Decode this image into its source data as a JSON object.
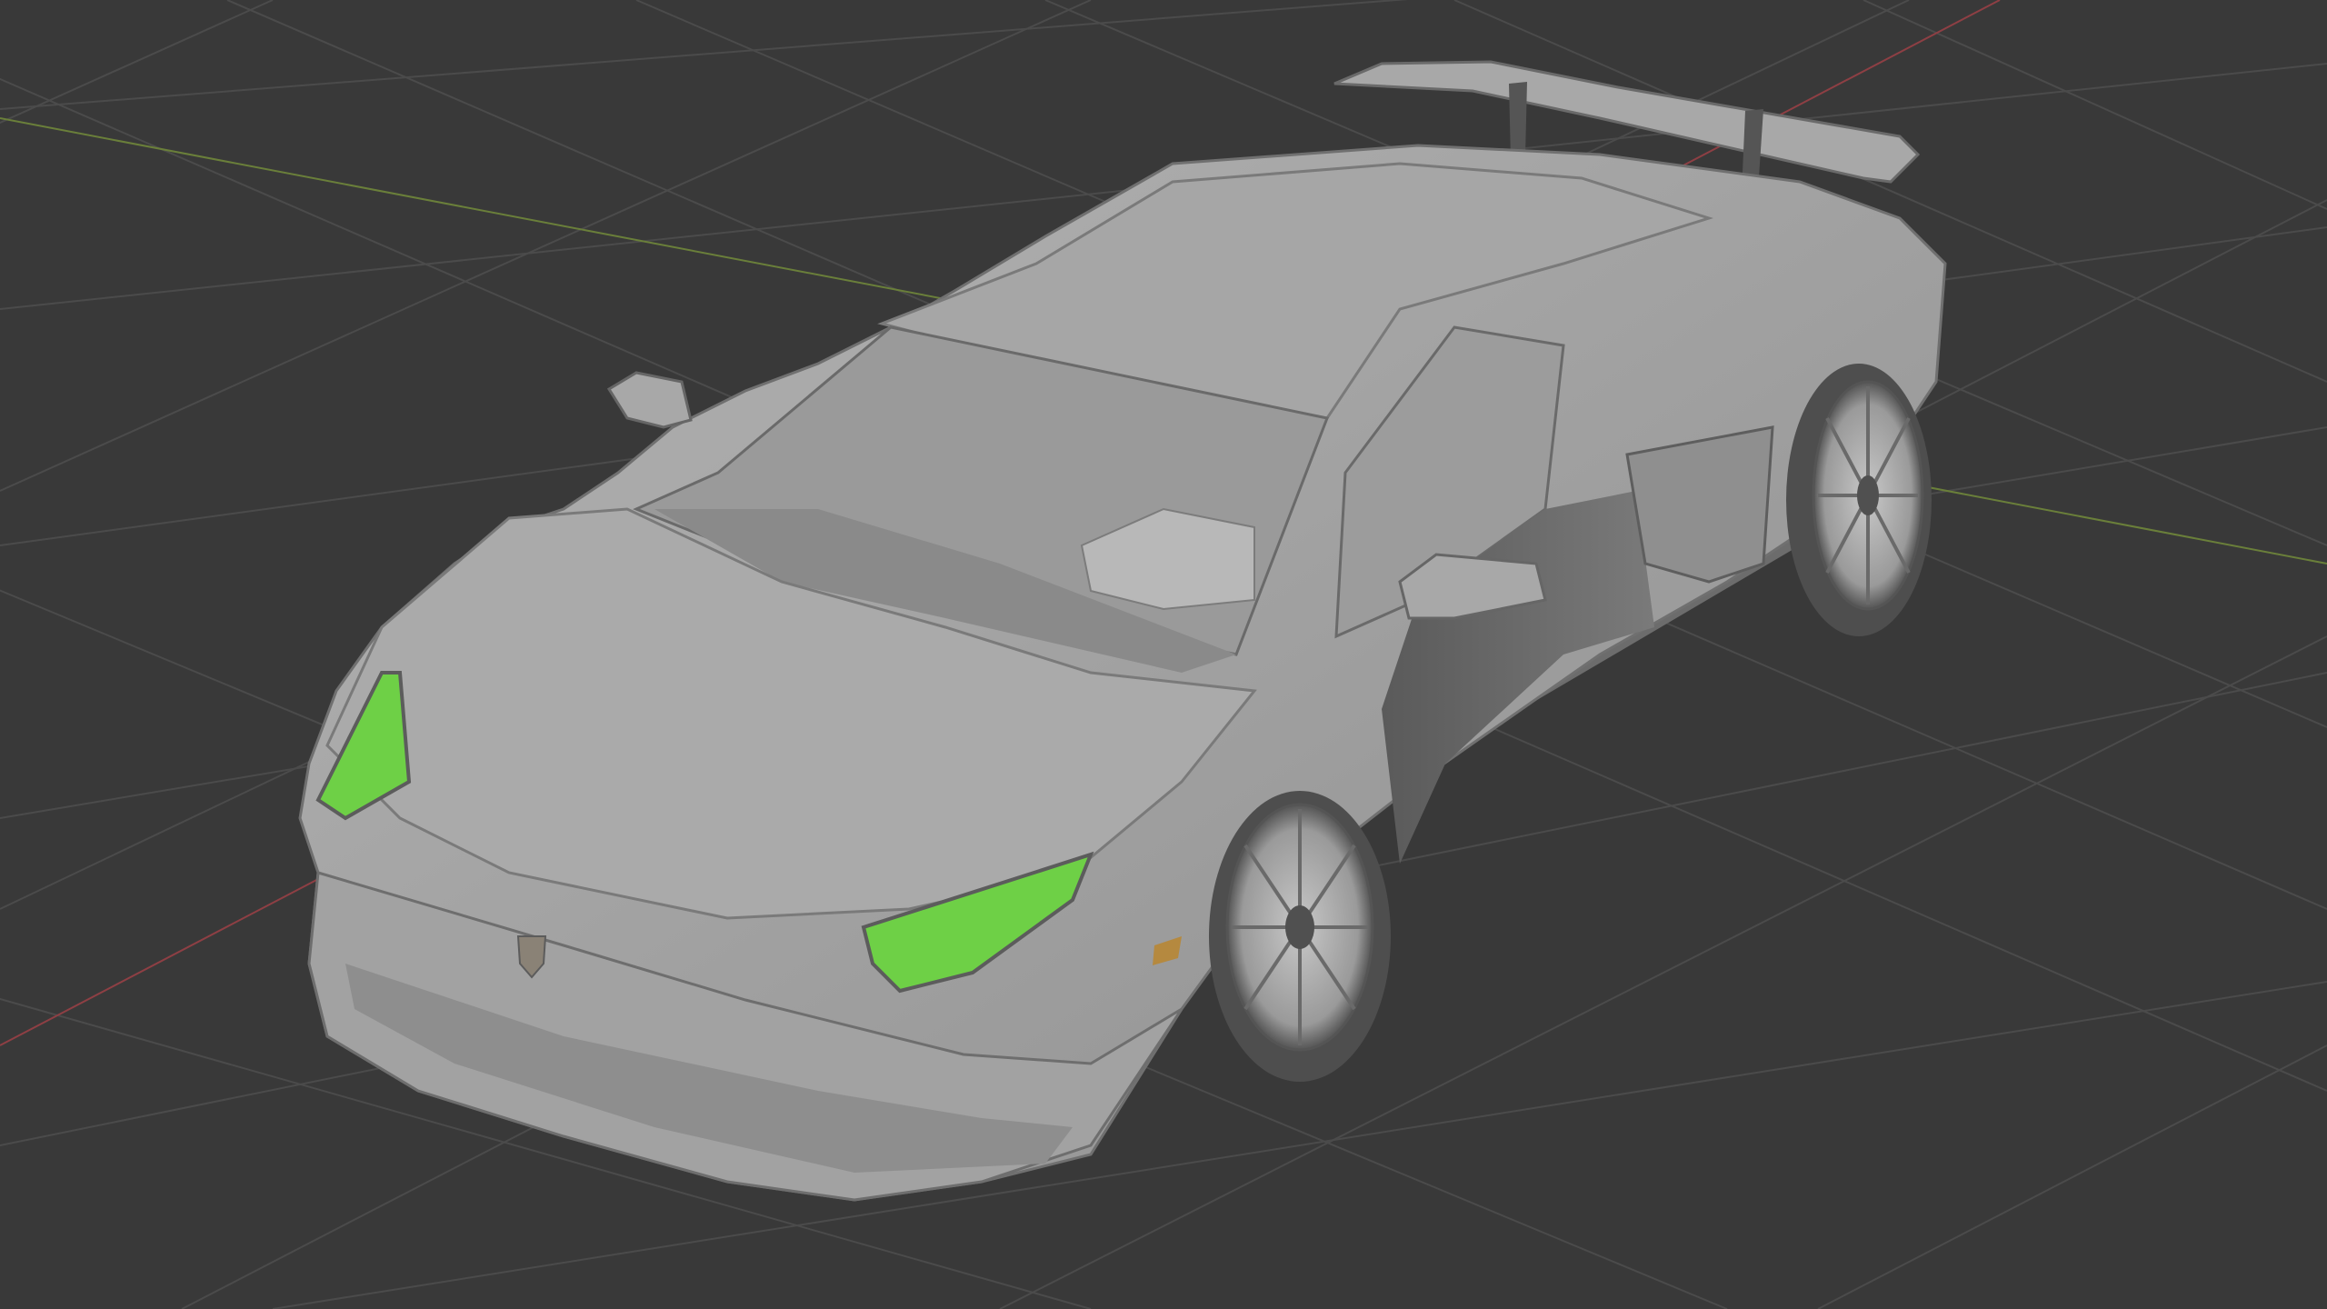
{
  "viewport": {
    "mode": "solid-shading",
    "background_color": "#393939",
    "grid_color": "#4b4b4b",
    "x_axis_color": "#8e3f44",
    "y_axis_color": "#6a7f3a",
    "model_color": "#a9a9a9",
    "model_shadow_color": "#6c6c6c",
    "highlight_color": "#6ed046",
    "model_object": "car-model"
  }
}
